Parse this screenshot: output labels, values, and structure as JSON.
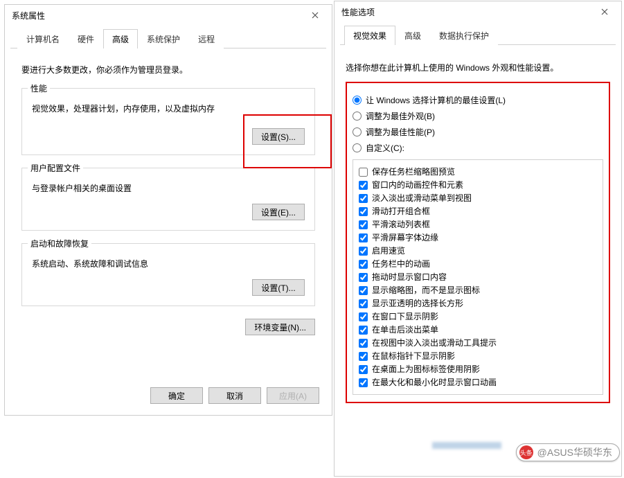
{
  "left": {
    "title": "系统属性",
    "tabs": [
      "计算机名",
      "硬件",
      "高级",
      "系统保护",
      "远程"
    ],
    "activeTabIndex": 2,
    "intro": "要进行大多数更改，你必须作为管理员登录。",
    "groups": {
      "perf": {
        "legend": "性能",
        "desc": "视觉效果，处理器计划，内存使用，以及虚拟内存",
        "button": "设置(S)..."
      },
      "userprof": {
        "legend": "用户配置文件",
        "desc": "与登录帐户相关的桌面设置",
        "button": "设置(E)..."
      },
      "startup": {
        "legend": "启动和故障恢复",
        "desc": "系统启动、系统故障和调试信息",
        "button": "设置(T)..."
      }
    },
    "envvar": "环境变量(N)...",
    "ok": "确定",
    "cancel": "取消",
    "apply": "应用(A)"
  },
  "right": {
    "title": "性能选项",
    "tabs": [
      "视觉效果",
      "高级",
      "数据执行保护"
    ],
    "activeTabIndex": 0,
    "intro": "选择你想在此计算机上使用的 Windows 外观和性能设置。",
    "radios": [
      {
        "label": "让 Windows 选择计算机的最佳设置(L)",
        "checked": true
      },
      {
        "label": "调整为最佳外观(B)",
        "checked": false
      },
      {
        "label": "调整为最佳性能(P)",
        "checked": false
      },
      {
        "label": "自定义(C):",
        "checked": false
      }
    ],
    "checks": [
      {
        "label": "保存任务栏缩略图预览",
        "checked": false
      },
      {
        "label": "窗口内的动画控件和元素",
        "checked": true
      },
      {
        "label": "淡入淡出或滑动菜单到视图",
        "checked": true
      },
      {
        "label": "滑动打开组合框",
        "checked": true
      },
      {
        "label": "平滑滚动列表框",
        "checked": true
      },
      {
        "label": "平滑屏幕字体边缘",
        "checked": true
      },
      {
        "label": "启用速览",
        "checked": true
      },
      {
        "label": "任务栏中的动画",
        "checked": true
      },
      {
        "label": "拖动时显示窗口内容",
        "checked": true
      },
      {
        "label": "显示缩略图，而不是显示图标",
        "checked": true
      },
      {
        "label": "显示亚透明的选择长方形",
        "checked": true
      },
      {
        "label": "在窗口下显示阴影",
        "checked": true
      },
      {
        "label": "在单击后淡出菜单",
        "checked": true
      },
      {
        "label": "在视图中淡入淡出或滑动工具提示",
        "checked": true
      },
      {
        "label": "在鼠标指针下显示阴影",
        "checked": true
      },
      {
        "label": "在桌面上为图标标签使用阴影",
        "checked": true
      },
      {
        "label": "在最大化和最小化时显示窗口动画",
        "checked": true
      }
    ]
  },
  "watermark": {
    "prefix": "头条",
    "at": "@",
    "name": "ASUS华硕华东"
  }
}
